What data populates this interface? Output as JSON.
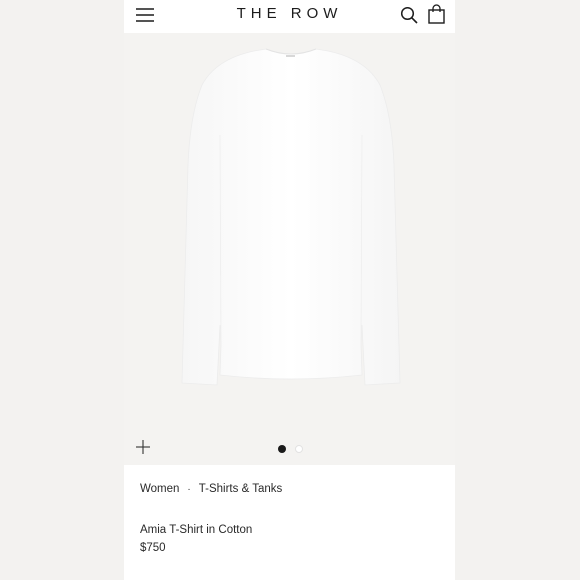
{
  "header": {
    "brand": "THE ROW",
    "menu_icon": "hamburger-menu-icon",
    "search_icon": "search-icon",
    "bag_icon": "shopping-bag-icon"
  },
  "gallery": {
    "zoom_icon": "plus-icon",
    "slide_count": 2,
    "active_slide": 1
  },
  "breadcrumb": {
    "items": [
      "Women",
      "T-Shirts & Tanks"
    ],
    "separator": "·"
  },
  "product": {
    "name": "Amia T-Shirt in Cotton",
    "price": "$750"
  },
  "colors": {
    "page_background": "#f2f1ef",
    "gallery_background": "#f4f3f1",
    "text": "#2a2a2a"
  }
}
